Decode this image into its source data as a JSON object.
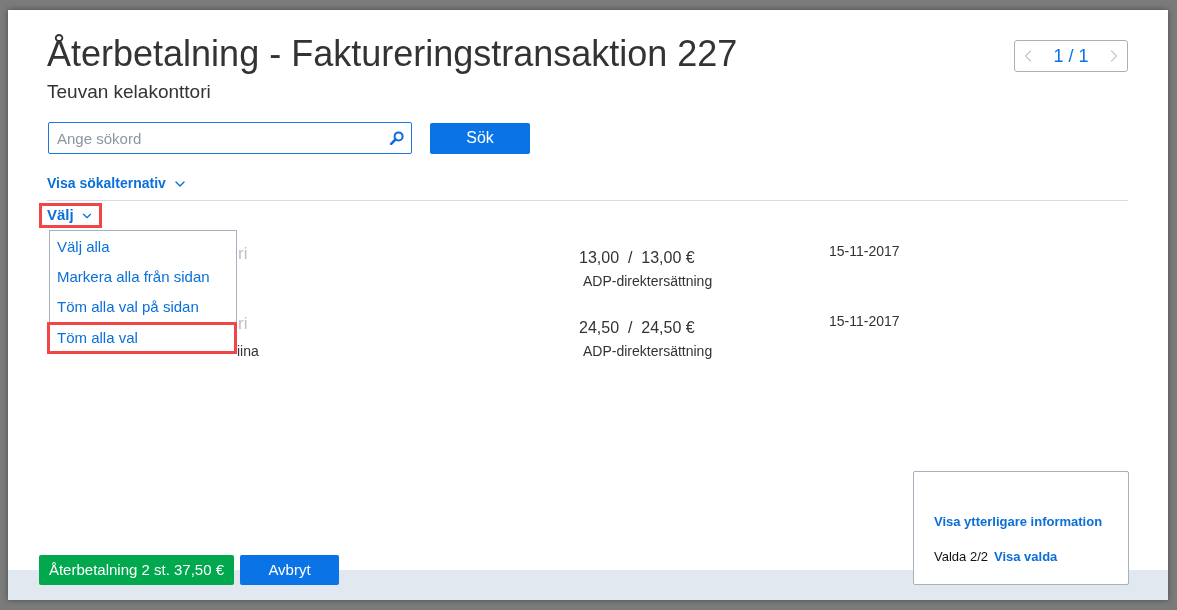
{
  "dialog": {
    "title": "Återbetalning - Faktureringstransaktion 227",
    "subtitle": "Teuvan kelakonttori"
  },
  "pager": {
    "label": "1 / 1",
    "prev_disabled": true,
    "next_disabled": true
  },
  "search": {
    "placeholder": "Ange sökord",
    "button": "Sök"
  },
  "search_options_link": "Visa sökalternativ",
  "select_menu": {
    "label": "Välj",
    "highlighted": true,
    "expanded": true,
    "items": [
      {
        "label": "Välj alla",
        "highlighted": false
      },
      {
        "label": "Markera alla från sidan",
        "highlighted": false
      },
      {
        "label": "Töm alla val på sidan",
        "highlighted": false
      },
      {
        "label": "Töm alla val",
        "highlighted": true
      }
    ]
  },
  "rows": [
    {
      "name": "ri",
      "amount": "13,00  /  13,00 €",
      "type": "ADP-direktersättning",
      "date": "15-11-2017"
    },
    {
      "name": "ri",
      "detail": "iina",
      "amount": "24,50  /  24,50 €",
      "type": "ADP-direktersättning",
      "date": "15-11-2017"
    }
  ],
  "info_panel": {
    "more_info_link": "Visa ytterligare information",
    "selected_count": "Valda 2/2",
    "show_selected_link": "Visa valda"
  },
  "buttons": [
    {
      "label": "Återbetalning 2 st. 37,50 €",
      "kind": "confirm"
    },
    {
      "label": "Avbryt",
      "kind": "cancel"
    }
  ]
}
